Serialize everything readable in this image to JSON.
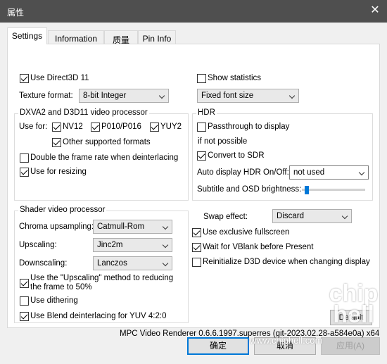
{
  "window": {
    "title": "属性",
    "close_glyph": "✕"
  },
  "tabs": [
    "Settings",
    "Information",
    "质量",
    "Pin Info"
  ],
  "left": {
    "use_d3d11": {
      "label": "Use Direct3D 11",
      "checked": true
    },
    "texture_format": {
      "label": "Texture format:",
      "value": "8-bit Integer"
    },
    "dxva_group": {
      "title": "DXVA2 and D3D11 video processor",
      "use_for": "Use for:",
      "nv12": {
        "label": "NV12",
        "checked": true
      },
      "p010": {
        "label": "P010/P016",
        "checked": true
      },
      "yuy2": {
        "label": "YUY2",
        "checked": true
      },
      "other_formats": {
        "label": "Other supported formats",
        "checked": true
      },
      "double_frame": {
        "label": "Double the frame rate when deinterlacing",
        "checked": false
      },
      "resizing": {
        "label": "Use for resizing",
        "checked": true
      }
    },
    "shader_group": {
      "title": "Shader video processor",
      "chroma": {
        "label": "Chroma upsampling:",
        "value": "Catmull-Rom"
      },
      "upscaling": {
        "label": "Upscaling:",
        "value": "Jinc2m"
      },
      "downscaling": {
        "label": "Downscaling:",
        "value": "Lanczos"
      },
      "use_upscaling_method": {
        "label_line1": "Use the \"Upscaling\" method to reducing",
        "label_line2": "the frame to 50%",
        "checked": true
      },
      "dithering": {
        "label": "Use dithering",
        "checked": false
      },
      "blend_deint": {
        "label": "Use Blend deinterlacing for YUV 4:2:0",
        "checked": true
      }
    }
  },
  "right": {
    "show_stats": {
      "label": "Show statistics",
      "checked": false
    },
    "font_size": {
      "value": "Fixed font size"
    },
    "hdr_group": {
      "title": "HDR",
      "passthrough": {
        "label": "Passthrough to display",
        "checked": false
      },
      "if_not_possible": "if not possible",
      "convert_sdr": {
        "label": "Convert to SDR",
        "checked": true
      },
      "auto_hdr": {
        "label": "Auto display HDR On/Off:",
        "value": "not used"
      },
      "subtitle_brightness": {
        "label": "Subtitle and OSD brightness:",
        "level": 0.04
      }
    },
    "swap_effect": {
      "label": "Swap effect:",
      "value": "Discard"
    },
    "exclusive_fullscreen": {
      "label": "Use exclusive fullscreen",
      "checked": true
    },
    "wait_vblank": {
      "label": "Wait for VBlank before Present",
      "checked": true
    },
    "reinit_d3d": {
      "label": "Reinitialize D3D device when changing display",
      "checked": false
    },
    "default_button": "Default"
  },
  "version": "MPC Video Renderer 0.6.6.1997.superres (git-2023.02.28-a584e0a) x64",
  "buttons": {
    "ok": "确定",
    "cancel": "取消",
    "apply": "应用(A)"
  },
  "watermark": {
    "logo": "chip hell",
    "url": "www.chiphell.com"
  }
}
